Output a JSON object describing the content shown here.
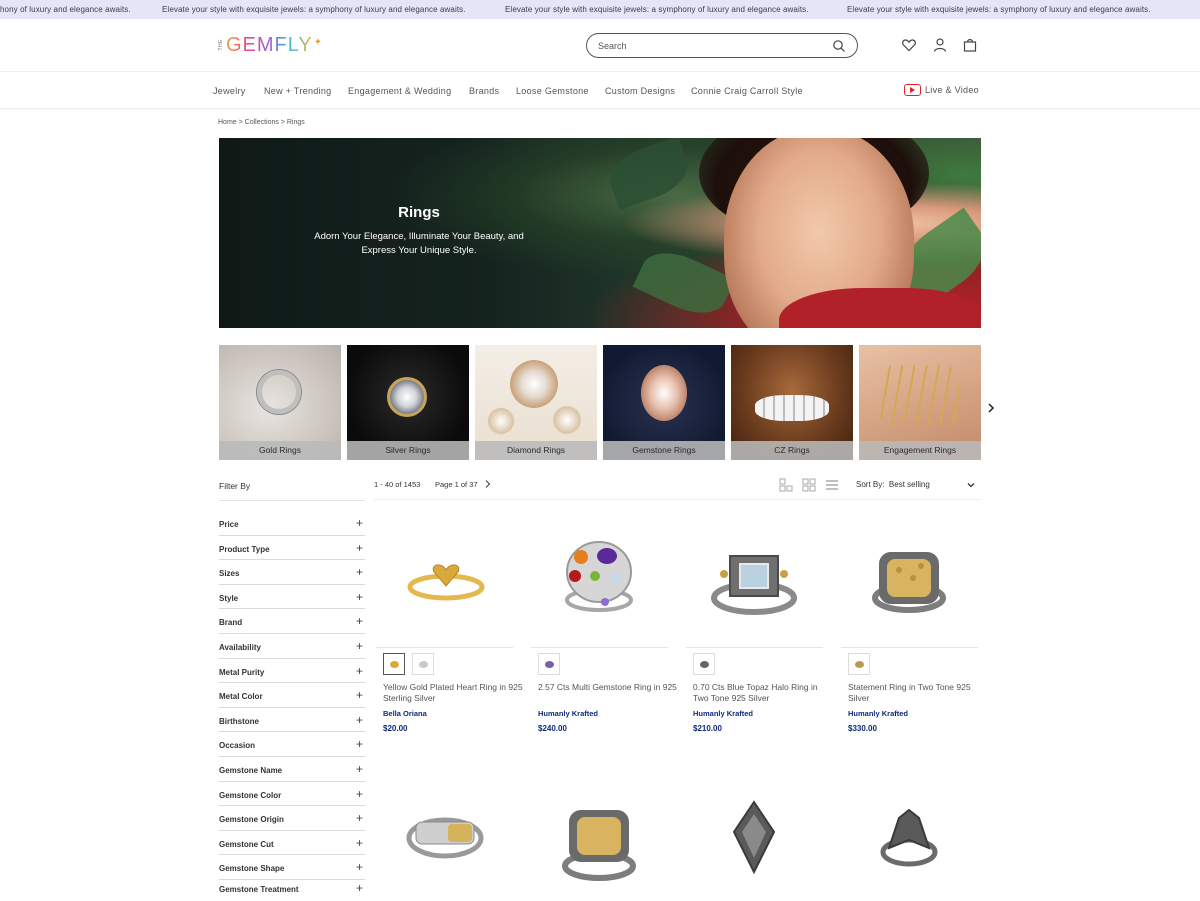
{
  "announcement": {
    "items": [
      "hony of luxury and elegance awaits.",
      "Elevate your style with exquisite jewels: a symphony of luxury and elegance awaits.",
      "Elevate your style with exquisite jewels: a symphony of luxury and elegance awaits.",
      "Elevate your style with exquisite jewels: a symphony of luxury and elegance awaits."
    ]
  },
  "header": {
    "logo_the": "THE",
    "logo_word": "GEMFLY",
    "search_placeholder": "Search"
  },
  "nav": {
    "items": [
      "Jewelry",
      "New + Trending",
      "Engagement & Wedding",
      "Brands",
      "Loose Gemstone",
      "Custom Designs",
      "Connie Craig Carroll Style"
    ],
    "live_label": "Live & Video"
  },
  "breadcrumb": "Home > Collections > Rings",
  "hero": {
    "title": "Rings",
    "subtitle": "Adorn Your Elegance, Illuminate Your Beauty, and Express Your Unique Style."
  },
  "categories": [
    "Gold Rings",
    "Silver Rings",
    "Diamond Rings",
    "Gemstone Rings",
    "CZ Rings",
    "Engagement Rings"
  ],
  "filter": {
    "title": "Filter By",
    "items": [
      "Price",
      "Product Type",
      "Sizes",
      "Style",
      "Brand",
      "Availability",
      "Metal Purity",
      "Metal Color",
      "Birthstone",
      "Occasion",
      "Gemstone Name",
      "Gemstone Color",
      "Gemstone Origin",
      "Gemstone Cut",
      "Gemstone Shape",
      "Gemstone Treatment"
    ],
    "plus": "+"
  },
  "toolbar": {
    "count": "1 - 40 of 1453",
    "page": "Page 1 of 37",
    "sort_label": "Sort By:",
    "sort_value": "Best selling"
  },
  "products": [
    {
      "name": "Yellow Gold Plated Heart Ring in 925 Sterling Silver",
      "brand": "Bella Oriana",
      "price": "$20.00"
    },
    {
      "name": "2.57 Cts Multi Gemstone Ring in 925",
      "brand": "Humanly Krafted",
      "price": "$240.00"
    },
    {
      "name": "0.70 Cts Blue Topaz Halo Ring in Two Tone 925 Silver",
      "brand": "Humanly Krafted",
      "price": "$210.00"
    },
    {
      "name": "Statement Ring in Two Tone 925 Silver",
      "brand": "Humanly Krafted",
      "price": "$330.00"
    }
  ],
  "colors": {
    "announcement_bg": "#e6e4f7",
    "brand_blue": "#0e2a7a",
    "youtube_red": "#e02424"
  }
}
